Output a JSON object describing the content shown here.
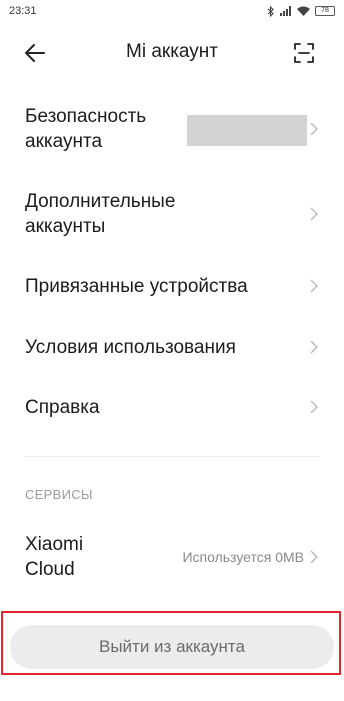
{
  "status_bar": {
    "time": "23:31",
    "battery": "78",
    "icons": [
      "bluetooth-icon",
      "signal-icon",
      "wifi-icon",
      "battery-icon"
    ]
  },
  "header": {
    "title": "Mi аккаунт",
    "back_icon": "arrow-left-icon",
    "scan_icon": "qr-scan-icon"
  },
  "menu": {
    "items": [
      {
        "line1": "Безопасность",
        "line2": "аккаунта"
      },
      {
        "line1": "Дополнительные",
        "line2": "аккаунты"
      },
      {
        "line1": "Привязанные устройства"
      },
      {
        "line1": "Условия использования"
      },
      {
        "line1": "Справка"
      }
    ]
  },
  "services": {
    "section_title": "СЕРВИСЫ",
    "cloud": {
      "line1": "Xiaomi",
      "line2": "Cloud",
      "value": "Используется 0MB"
    }
  },
  "logout": {
    "label": "Выйти из аккаунта"
  },
  "colors": {
    "highlight": "#e0252e",
    "button_bg": "#ececec",
    "secondary_text": "#8a8a8a"
  }
}
